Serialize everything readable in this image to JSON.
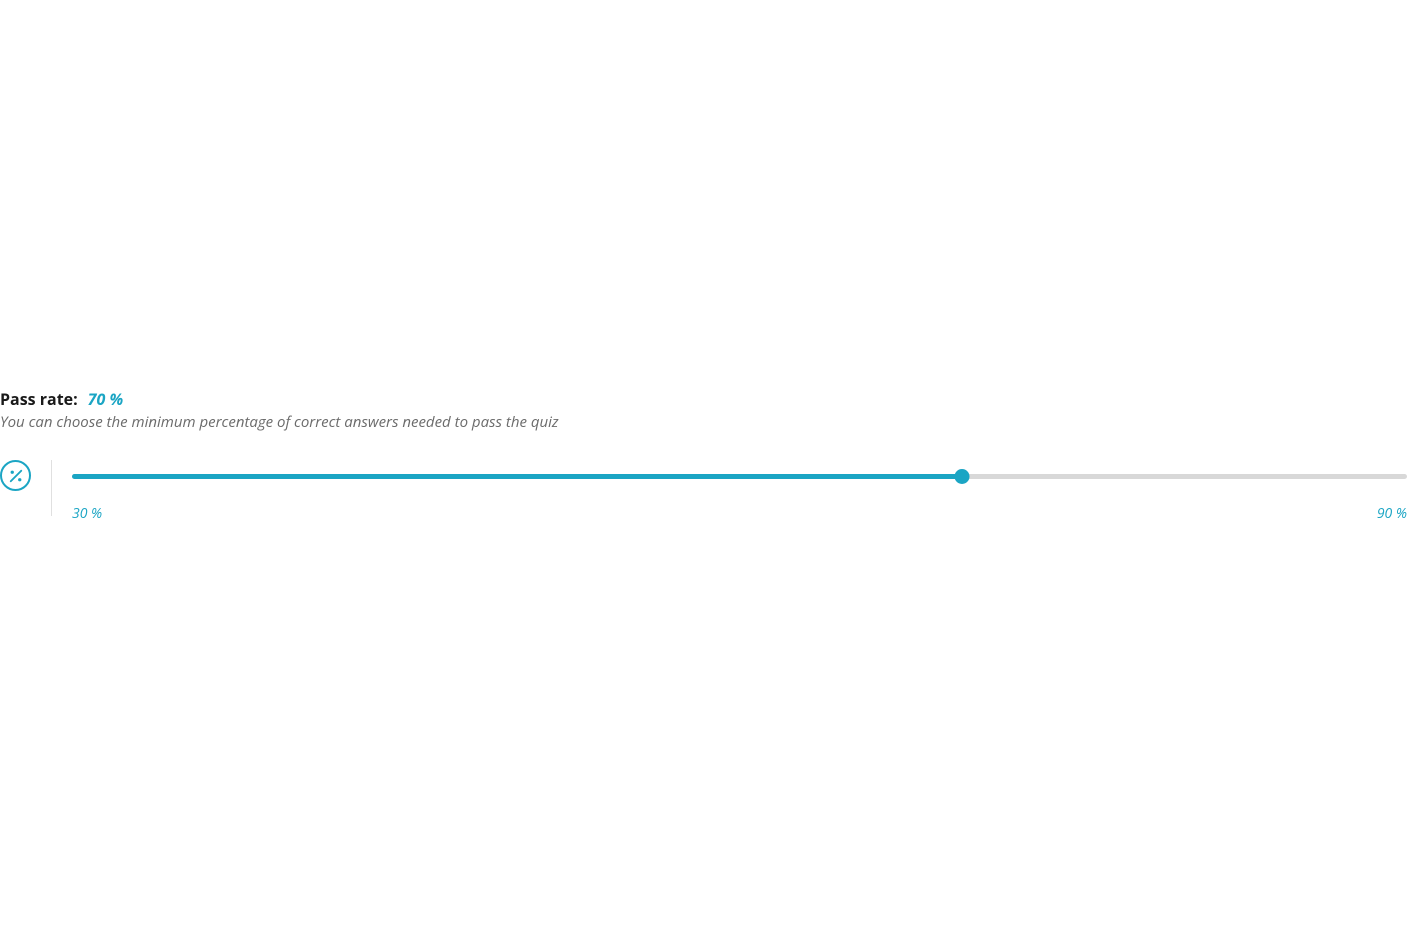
{
  "passRate": {
    "label": "Pass rate:",
    "value": "70 %",
    "description": "You can choose the minimum percentage of correct answers needed to pass the quiz",
    "slider": {
      "min": 30,
      "max": 90,
      "current": 70,
      "minLabel": "30 %",
      "maxLabel": "90 %",
      "fillPercent": 66.67
    }
  },
  "colors": {
    "accent": "#1ba5c4",
    "textPrimary": "#1a1a1a",
    "textMuted": "#6b6b6b",
    "trackBg": "#d8d8d8"
  }
}
